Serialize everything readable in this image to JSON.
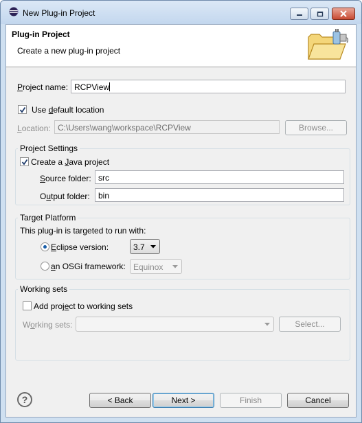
{
  "window": {
    "title": "New Plug-in Project"
  },
  "banner": {
    "title": "Plug-in Project",
    "subtitle": "Create a new plug-in project",
    "icon": "folder-plug-icon"
  },
  "project_name": {
    "label_prefix": "",
    "label_u": "P",
    "label_rest": "roject name:",
    "value": "RCPView"
  },
  "use_default_location": {
    "checked": true,
    "label_pre": "Use ",
    "label_u": "d",
    "label_rest": "efault location"
  },
  "location": {
    "label_u": "L",
    "label_rest": "ocation:",
    "value": "C:\\Users\\wang\\workspace\\RCPView",
    "browse_label": "Browse..."
  },
  "project_settings": {
    "title": "Project Settings",
    "create_java": {
      "checked": true,
      "label_pre": "Create a ",
      "label_u": "J",
      "label_rest": "ava project"
    },
    "source_folder": {
      "label_u": "S",
      "label_rest": "ource folder:",
      "value": "src"
    },
    "output_folder": {
      "label_pre": "O",
      "label_u": "u",
      "label_rest": "tput folder:",
      "value": "bin"
    }
  },
  "target_platform": {
    "title": "Target Platform",
    "description": "This plug-in is targeted to run with:",
    "eclipse": {
      "selected": true,
      "label_u": "E",
      "label_rest": "clipse version:",
      "value": "3.7"
    },
    "osgi": {
      "selected": false,
      "label_pre": "",
      "label_u": "a",
      "label_rest": "n OSGi framework:",
      "value": "Equinox"
    }
  },
  "working_sets": {
    "title": "Working sets",
    "add": {
      "checked": false,
      "label_pre": "Add proj",
      "label_u": "e",
      "label_rest": "ct to working sets"
    },
    "sets_label_pre": "W",
    "sets_label_u": "o",
    "sets_label_rest": "rking sets:",
    "sets_value": "",
    "select_label": "Select..."
  },
  "footer": {
    "back_label": "< Back",
    "next_label": "Next >",
    "finish_label": "Finish",
    "cancel_label": "Cancel"
  }
}
